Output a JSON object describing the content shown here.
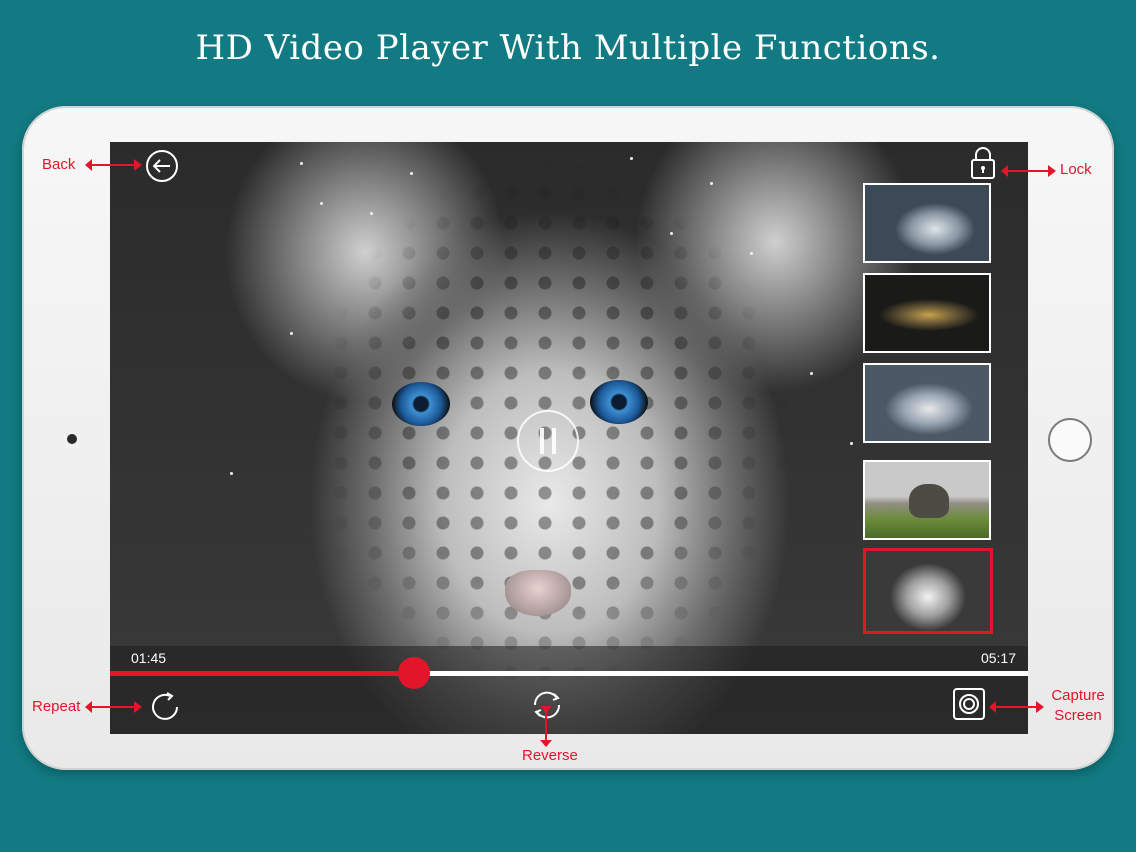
{
  "headline": "HD Video Player With Multiple Functions.",
  "player": {
    "current_time": "01:45",
    "total_time": "05:17",
    "progress_fraction": 0.331,
    "state": "playing",
    "icons": {
      "back": "back-arrow-icon",
      "lock": "lock-icon",
      "pause": "pause-icon",
      "repeat": "repeat-icon",
      "reverse": "reverse-icon",
      "capture": "capture-screen-icon"
    }
  },
  "playlist": {
    "items": [
      {
        "subject": "wolf"
      },
      {
        "subject": "sports car"
      },
      {
        "subject": "snow leopard"
      },
      {
        "subject": "elephant"
      },
      {
        "subject": "snow leopard",
        "selected": true
      }
    ]
  },
  "callouts": {
    "back": "Back",
    "lock": "Lock",
    "repeat": "Repeat",
    "reverse": "Reverse",
    "capture_line1": "Capture",
    "capture_line2": "Screen"
  },
  "colors": {
    "background": "#127a82",
    "accent": "#e3152b",
    "device_frame": "#f2f2f2"
  }
}
